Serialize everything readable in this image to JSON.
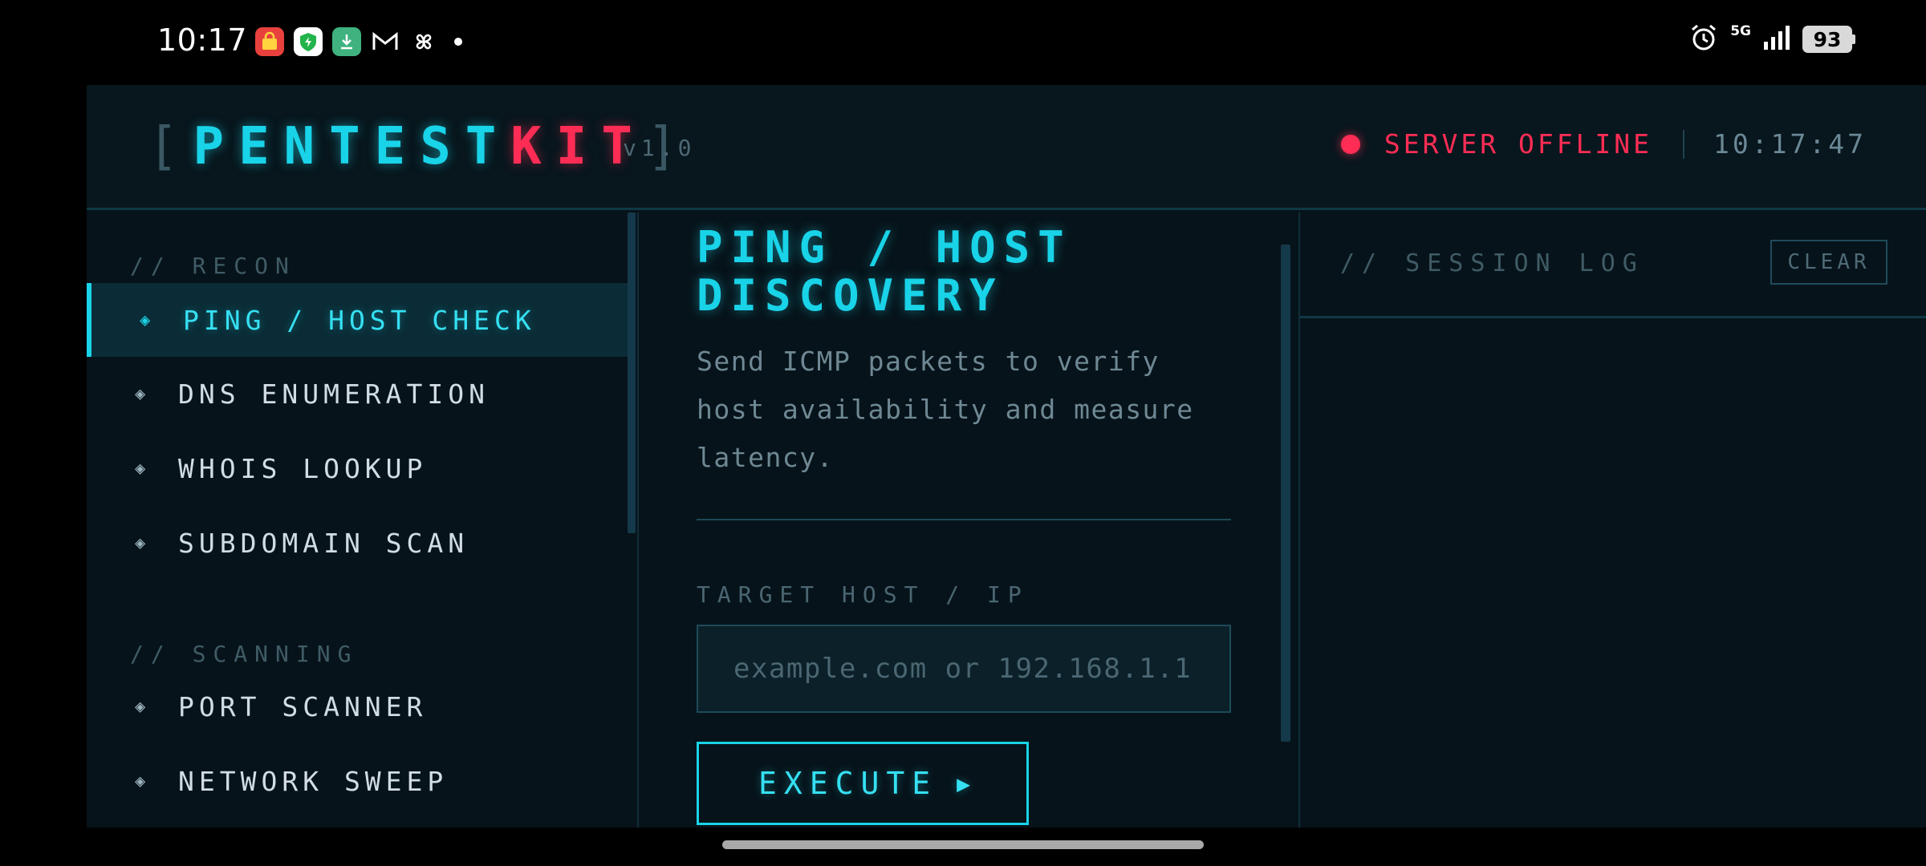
{
  "status_bar": {
    "time": "10:17",
    "network": "5G",
    "battery": "93",
    "app_icons": [
      "shopping-bag-icon",
      "shield-bolt-icon",
      "download-icon",
      "gmail-icon",
      "pinwheel-icon"
    ]
  },
  "header": {
    "logo_bracket_left": "[",
    "logo_part1": "PENTEST",
    "logo_part2": "KIT",
    "logo_bracket_right": "]",
    "version": "v1.0",
    "server_status": "SERVER OFFLINE",
    "clock": "10:17:47"
  },
  "sidebar": {
    "sections": [
      {
        "label": "// RECON"
      },
      {
        "label": "// SCANNING"
      }
    ],
    "items": [
      {
        "label": "PING / HOST CHECK",
        "active": true
      },
      {
        "label": "DNS ENUMERATION"
      },
      {
        "label": "WHOIS LOOKUP"
      },
      {
        "label": "SUBDOMAIN SCAN"
      },
      {
        "label": "PORT SCANNER"
      },
      {
        "label": "NETWORK SWEEP"
      }
    ],
    "bullet": "◈"
  },
  "main": {
    "title": "PING / HOST DISCOVERY",
    "description": "Send ICMP packets to verify host availability and measure latency.",
    "target_label": "TARGET HOST / IP",
    "target_value": "",
    "target_placeholder": "example.com or 192.168.1.1",
    "execute_label": "EXECUTE",
    "execute_arrow": "▶"
  },
  "log": {
    "title": "// SESSION LOG",
    "clear_label": "CLEAR",
    "entries": []
  },
  "colors": {
    "accent": "#19d3e8",
    "danger": "#ff2d55",
    "background": "#07131a",
    "border": "#0f3946"
  }
}
